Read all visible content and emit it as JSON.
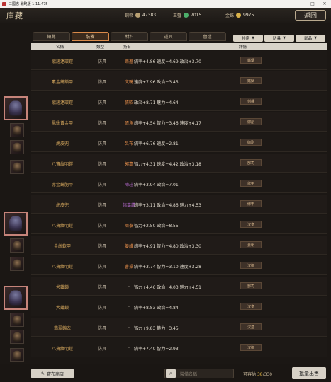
{
  "window": {
    "title": "三國志 戰略版 1.11.475",
    "minimize": "—",
    "maximize": "□",
    "close": "✕"
  },
  "header": {
    "title": "庫藏",
    "resources": [
      {
        "label": "銅幣",
        "value": "47383",
        "color": "#b8a072"
      },
      {
        "label": "玉璧",
        "value": "7015",
        "color": "#4caf6a"
      },
      {
        "label": "金銖",
        "value": "9975",
        "color": "#d9b24a"
      }
    ],
    "back_label": "返回"
  },
  "tabs": [
    {
      "label": "總覽",
      "active": false
    },
    {
      "label": "裝備",
      "active": true
    },
    {
      "label": "材料",
      "active": false
    },
    {
      "label": "道具",
      "active": false
    },
    {
      "label": "營造",
      "active": false
    }
  ],
  "filters": [
    {
      "label": "排序",
      "arrow": "▼"
    },
    {
      "label": "防具",
      "arrow": "▼"
    },
    {
      "label": "部品",
      "arrow": "▼"
    }
  ],
  "table": {
    "headers": {
      "name": "名稱",
      "type": "類型",
      "holder": "持有",
      "stats": "詳情"
    },
    "rows": [
      {
        "name": "歌謠連環鎧",
        "type": "防具",
        "holder": "樂進",
        "holder_color": "orange",
        "stats": "統率+4.86  速度+4.69  政治+3.70",
        "tag": "鐵鑄"
      },
      {
        "name": "素金鏡鎖甲",
        "type": "防具",
        "holder": "文聘",
        "holder_color": "orange",
        "stats": "速度+7.96  政治+3.45",
        "tag": "鐵鑄"
      },
      {
        "name": "歌謠連環鎧",
        "type": "防具",
        "holder": "張昭",
        "holder_color": "orange",
        "stats": "政治+8.71  魅力+4.64",
        "tag": "刻鏤"
      },
      {
        "name": "鳳翅黃金甲",
        "type": "防具",
        "holder": "張角",
        "holder_color": "orange",
        "stats": "統率+4.54  智力+3.46  速度+4.17",
        "tag": "御副"
      },
      {
        "name": "虎皮兜",
        "type": "防具",
        "holder": "呂布",
        "holder_color": "orange",
        "stats": "統率+6.76  速度+2.81",
        "tag": "御副"
      },
      {
        "name": "八寶紋明鎧",
        "type": "防具",
        "holder": "郭嘉",
        "holder_color": "orange",
        "stats": "智力+4.31  速度+4.42  政治+3.18",
        "tag": "部司"
      },
      {
        "name": "赤金鏡肥甲",
        "type": "防具",
        "holder": "陳珪",
        "holder_color": "purple",
        "stats": "統率+3.94  政治+7.01",
        "tag": "修甲"
      },
      {
        "name": "虎皮兜",
        "type": "防具",
        "holder": "諸葛謹",
        "holder_color": "purple",
        "stats": "統率+3.11  政治+4.86  魅力+4.53",
        "tag": "修甲"
      },
      {
        "name": "八寶紋明鎧",
        "type": "防具",
        "holder": "周泰",
        "holder_color": "orange",
        "stats": "智力+2.50  政治+8.55",
        "tag": "汉皇"
      },
      {
        "name": "金絲軟甲",
        "type": "防具",
        "holder": "姜維",
        "holder_color": "orange",
        "stats": "統率+4.91  智力+4.80  政治+3.30",
        "tag": "貴朝"
      },
      {
        "name": "八寶紋明鎧",
        "type": "防具",
        "holder": "曹操",
        "holder_color": "orange",
        "stats": "統率+3.74  智力+3.10  速度+3.28",
        "tag": "汉御"
      },
      {
        "name": "犬鐵鎖",
        "type": "防具",
        "holder": "--",
        "holder_color": "gray",
        "stats": "智力+4.46  政治+4.03  魅力+4.51",
        "tag": "部司"
      },
      {
        "name": "犬鐵鎖",
        "type": "防具",
        "holder": "--",
        "holder_color": "gray",
        "stats": "統率+8.83  政治+4.84",
        "tag": "汉皇"
      },
      {
        "name": "翡翠錦衣",
        "type": "防具",
        "holder": "--",
        "holder_color": "gray",
        "stats": "智力+9.83  魅力+3.45",
        "tag": "汉皇"
      },
      {
        "name": "八寶紋明鎧",
        "type": "防具",
        "holder": "--",
        "holder_color": "gray",
        "stats": "統率+7.40  智力+2.93",
        "tag": "汉御"
      }
    ]
  },
  "bottom": {
    "shop_label": "寶布商店",
    "search_placeholder": "裝備名稱",
    "capacity_label": "可容納",
    "capacity_used": "38",
    "capacity_total": "330",
    "sell_label": "批量出售"
  }
}
